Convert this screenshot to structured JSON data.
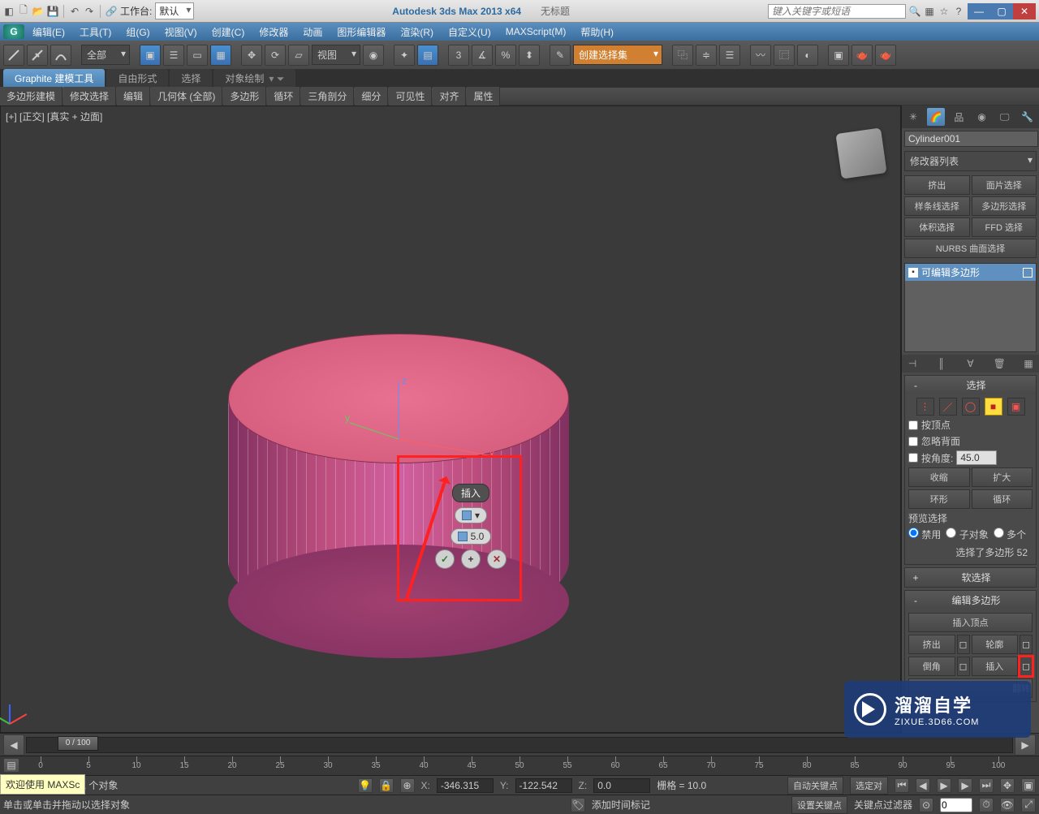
{
  "titlebar": {
    "workspace_label": "工作台:",
    "workspace_value": "默认",
    "app_title": "Autodesk 3ds Max  2013 x64",
    "doc_title": "无标题",
    "search_placeholder": "键入关键字或短语"
  },
  "menu": {
    "items": [
      "编辑(E)",
      "工具(T)",
      "组(G)",
      "视图(V)",
      "创建(C)",
      "修改器",
      "动画",
      "图形编辑器",
      "渲染(R)",
      "自定义(U)",
      "MAXScript(M)",
      "帮助(H)"
    ]
  },
  "toolbar": {
    "filter_all": "全部",
    "view_dropdown": "视图",
    "named_set": "创建选择集"
  },
  "ribbon": {
    "tabs": [
      "Graphite 建模工具",
      "自由形式",
      "选择",
      "对象绘制"
    ],
    "subtabs": [
      "多边形建模",
      "修改选择",
      "编辑",
      "几何体 (全部)",
      "多边形",
      "循环",
      "三角剖分",
      "细分",
      "可见性",
      "对齐",
      "属性"
    ]
  },
  "viewport": {
    "label": "[+] [正交] [真实 + 边面]"
  },
  "caddy": {
    "title": "插入",
    "value": "5.0",
    "ok": "✓",
    "plus": "+",
    "cancel": "✕"
  },
  "cmd": {
    "object_name": "Cylinder001",
    "modifier_list": "修改器列表",
    "mod_buttons": [
      "挤出",
      "面片选择",
      "样条线选择",
      "多边形选择",
      "体积选择",
      "FFD 选择",
      "NURBS 曲面选择"
    ],
    "stack_item": "可编辑多边形",
    "rollouts": {
      "selection": {
        "title": "选择",
        "by_vertex": "按顶点",
        "ignore_backfacing": "忽略背面",
        "by_angle": "按角度:",
        "angle_value": "45.0",
        "shrink": "收缩",
        "grow": "扩大",
        "ring": "环形",
        "loop": "循环",
        "preview_label": "预览选择",
        "preview_off": "禁用",
        "preview_subobj": "子对象",
        "preview_multi": "多个",
        "selected_info": "选择了多边形 52"
      },
      "soft_sel": {
        "title": "软选择"
      },
      "edit_poly": {
        "title": "编辑多边形",
        "insert_vertex": "插入顶点",
        "extrude": "挤出",
        "outline": "轮廓",
        "bevel": "倒角",
        "inset": "插入",
        "flip": "翻转"
      }
    }
  },
  "timeline": {
    "frame_display": "0 / 100",
    "ticks": [
      0,
      5,
      10,
      15,
      20,
      25,
      30,
      35,
      40,
      45,
      50,
      55,
      60,
      65,
      70,
      75,
      80,
      85,
      90,
      95,
      100
    ]
  },
  "status": {
    "selected": "选择了 1 个对象",
    "x_label": "X:",
    "x": "-346.315",
    "y_label": "Y:",
    "y": "-122.542",
    "z_label": "Z:",
    "z": "0.0",
    "grid": "栅格 = 10.0",
    "auto_key": "自动关键点",
    "set_key": "设置关键点",
    "key_filters": "关键点过滤器",
    "selected_set": "选定对",
    "prompt": "单击或单击并拖动以选择对象",
    "add_time_tag": "添加时间标记"
  },
  "welcome": "欢迎使用 MAXSc",
  "watermark": {
    "cn": "溜溜自学",
    "en": "ZIXUE.3D66.COM"
  }
}
